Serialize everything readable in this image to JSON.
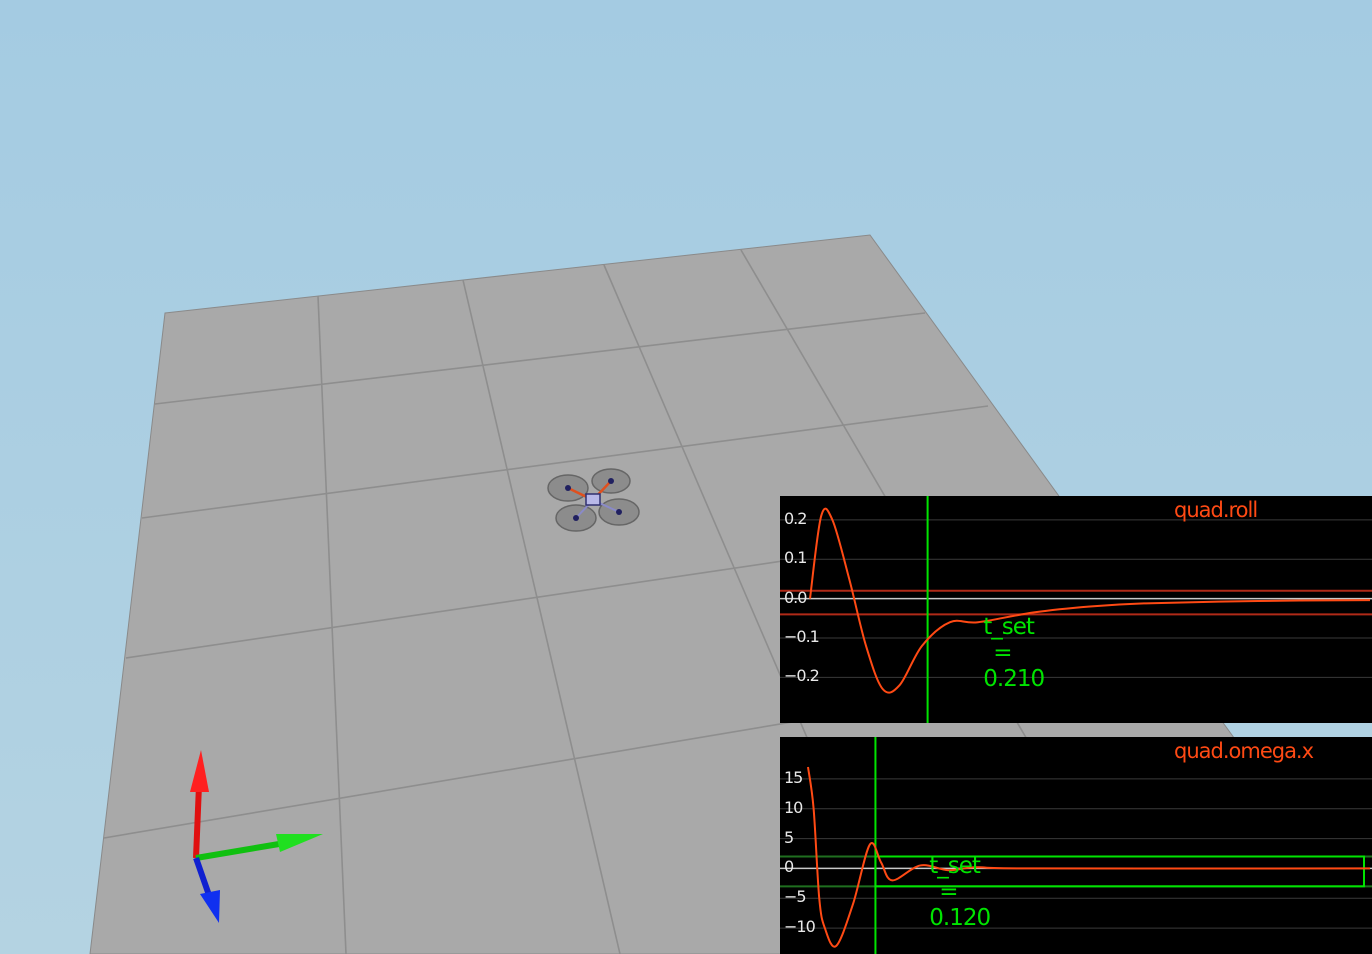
{
  "scene": {
    "sky_color": "#a6cde3",
    "floor_color": "#a8a8a8",
    "vehicle": "quadrotor",
    "axis_triad": [
      "x-axis-red",
      "y-axis-green",
      "z-axis-blue"
    ]
  },
  "colors": {
    "plot_background": "#000000",
    "trace": "#ff4a14",
    "threshold": "#00e400",
    "band": "#b02a18",
    "zero_line": "#c8c8c8"
  },
  "chart_data": [
    {
      "type": "line",
      "title": "quad.roll",
      "series": [
        {
          "name": "quad.roll",
          "x": [
            0.0,
            0.02,
            0.04,
            0.07,
            0.1,
            0.13,
            0.16,
            0.2,
            0.25,
            0.3,
            0.4,
            0.5,
            0.6,
            0.8,
            1.0
          ],
          "y": [
            0.0,
            0.21,
            0.2,
            0.05,
            -0.12,
            -0.23,
            -0.22,
            -0.12,
            -0.06,
            -0.06,
            -0.035,
            -0.02,
            -0.012,
            -0.006,
            -0.004
          ]
        }
      ],
      "yticks": [
        "0.2",
        "0.1",
        "0.0",
        "−0.1",
        "−0.2"
      ],
      "ylim": [
        -0.25,
        0.22
      ],
      "band": [
        -0.04,
        0.02
      ],
      "annotation": {
        "label": "t_set",
        "equals": "=",
        "value": "0.210"
      },
      "settle_time": 0.21
    },
    {
      "type": "line",
      "title": "quad.omega.x",
      "series": [
        {
          "name": "quad.omega.x",
          "x": [
            0.0,
            0.01,
            0.02,
            0.03,
            0.05,
            0.08,
            0.11,
            0.13,
            0.15,
            0.2,
            0.25,
            0.3,
            0.4,
            1.0
          ],
          "y": [
            17,
            10,
            -5,
            -10,
            -13,
            -6,
            4,
            1,
            -2,
            0.5,
            -0.3,
            0.2,
            0,
            0
          ]
        }
      ],
      "yticks": [
        "15",
        "10",
        "5",
        "0",
        "−5",
        "−10"
      ],
      "ylim": [
        -13,
        18
      ],
      "band": [
        -3,
        2
      ],
      "annotation": {
        "label": "t_set",
        "equals": "=",
        "value": "0.120"
      },
      "settle_time": 0.12
    }
  ]
}
